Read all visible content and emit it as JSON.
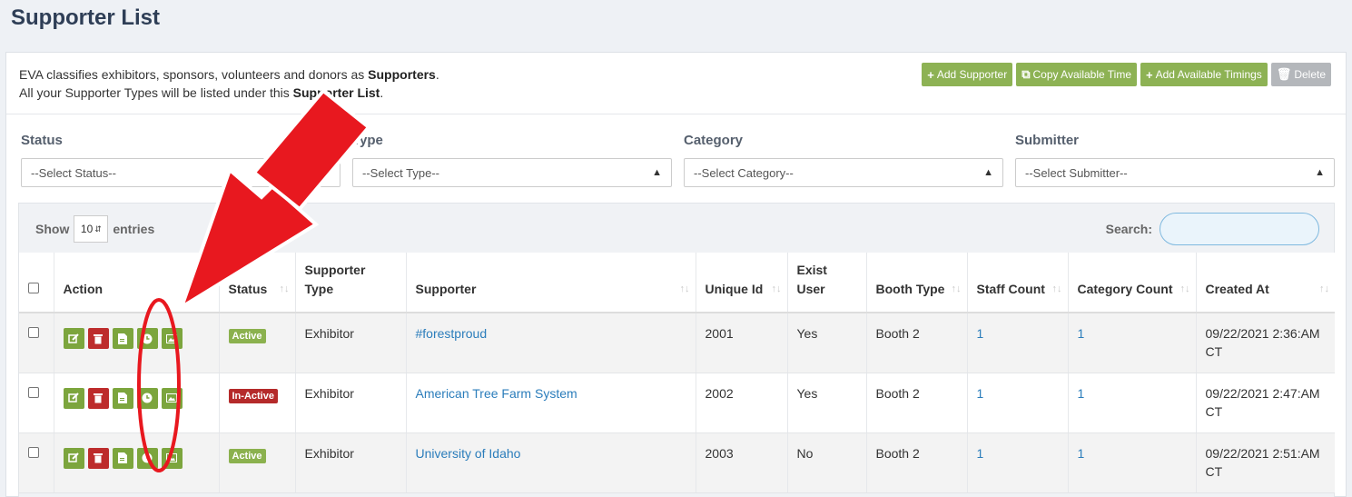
{
  "page_title": "Supporter List",
  "intro": {
    "line1_prefix": "EVA classifies exhibitors, sponsors, volunteers and donors as ",
    "line1_bold": "Supporters",
    "line1_suffix": ".",
    "line2_prefix": "All your Supporter Types will be listed under this ",
    "line2_bold": "Supporter List",
    "line2_suffix": "."
  },
  "toolbar": {
    "add_supporter": "Add Supporter",
    "copy_time": "Copy Available Time",
    "add_timings": "Add Available Timings",
    "delete": "Delete"
  },
  "filters": [
    {
      "label": "Status",
      "value": "--Select Status--"
    },
    {
      "label": "Type",
      "value": "--Select Type--"
    },
    {
      "label": "Category",
      "value": "--Select Category--"
    },
    {
      "label": "Submitter",
      "value": "--Select Submitter--"
    }
  ],
  "table_controls": {
    "show_label": "Show",
    "page_length": "10",
    "entries_label": "entries",
    "search_label": "Search:"
  },
  "columns": {
    "action": "Action",
    "status": "Status",
    "supporter_type": "Supporter Type",
    "supporter": "Supporter",
    "unique_id": "Unique Id",
    "exist_user": "Exist User",
    "booth_type": "Booth Type",
    "staff_count": "Staff Count",
    "category_count": "Category Count",
    "created_at": "Created At"
  },
  "rows": [
    {
      "status": "Active",
      "type": "Exhibitor",
      "supporter": "#forestproud",
      "unique_id": "2001",
      "exist_user": "Yes",
      "booth_type": "Booth 2",
      "staff_count": "1",
      "category_count": "1",
      "created_at": "09/22/2021 2:36:AM CT"
    },
    {
      "status": "In-Active",
      "type": "Exhibitor",
      "supporter": "American Tree Farm System",
      "unique_id": "2002",
      "exist_user": "Yes",
      "booth_type": "Booth 2",
      "staff_count": "1",
      "category_count": "1",
      "created_at": "09/22/2021 2:47:AM CT"
    },
    {
      "status": "Active",
      "type": "Exhibitor",
      "supporter": "University of Idaho",
      "unique_id": "2003",
      "exist_user": "No",
      "booth_type": "Booth 2",
      "staff_count": "1",
      "category_count": "1",
      "created_at": "09/22/2021 2:51:AM CT"
    }
  ],
  "colors": {
    "green": "#7ca53d",
    "red": "#bd2c2c",
    "link": "#2b7dbb",
    "annotation_red": "#e8181f"
  }
}
